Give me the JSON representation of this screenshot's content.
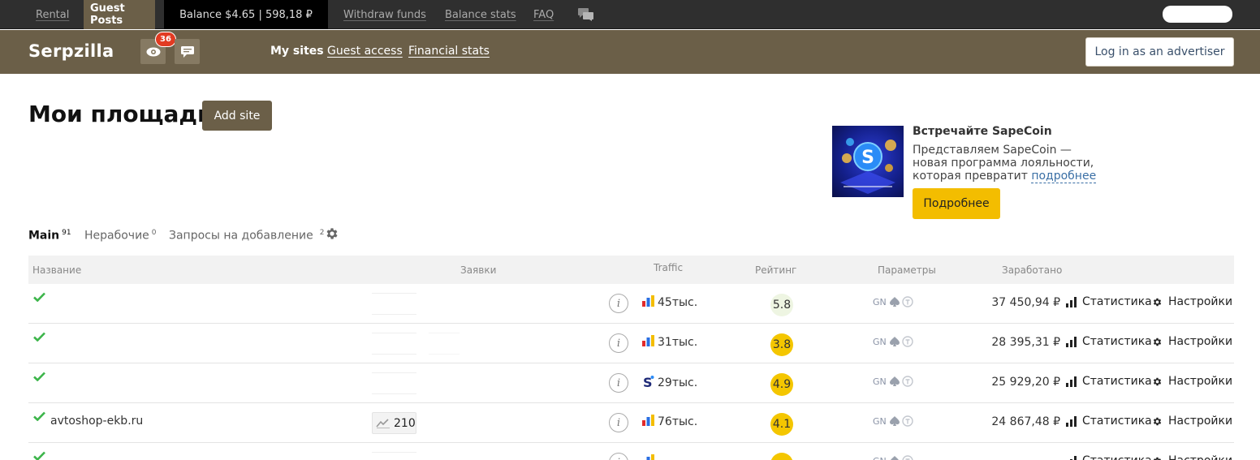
{
  "topbar": {
    "rental": "Rental",
    "guest_posts": "Guest Posts",
    "balance": "Balance $4.65 | 598,18 ₽",
    "withdraw": "Withdraw funds",
    "balance_stats": "Balance stats",
    "faq": "FAQ"
  },
  "header": {
    "logo": "Serpzilla",
    "views_badge": "36",
    "nav": {
      "my_sites": "My sites",
      "guest_access": "Guest access",
      "financial_stats": "Financial stats"
    },
    "advertiser_button": "Log in as an advertiser"
  },
  "page": {
    "title": "Мои площадки",
    "add_site": "Add site"
  },
  "promo": {
    "title": "Встречайте SapeCoin",
    "text": "Представляем SapeCoin — новая программа лояльности, которая превратит",
    "link": "подробнее",
    "button": "Подробнее"
  },
  "tabs": [
    {
      "label": "Main",
      "count": "91"
    },
    {
      "label": "Нерабочие",
      "count": "0"
    },
    {
      "label": "Запросы на добавление",
      "count": "2"
    }
  ],
  "table": {
    "columns": {
      "name": "Название",
      "requests": "Заявки",
      "traffic": "Traffic",
      "rating": "Рейтинг",
      "params": "Параметры",
      "earned": "Заработано"
    },
    "gn_label": "GN",
    "stat_label": "Статистика",
    "settings_label": "Настройки",
    "rows": [
      {
        "name": "",
        "requests": "",
        "traffic": "45тыс.",
        "traffic_src": "yandex",
        "rating": "5.8",
        "rating_color": "#eef5e2",
        "earned": "37 450,94 ₽"
      },
      {
        "name": "",
        "requests": "",
        "traffic": "31тыс.",
        "traffic_src": "yandex",
        "rating": "3.8",
        "rating_color": "#f4c600",
        "earned": "28 395,31 ₽"
      },
      {
        "name": "",
        "requests": "",
        "traffic": "29тыс.",
        "traffic_src": "sape",
        "rating": "4.9",
        "rating_color": "#f4c600",
        "earned": "25 929,20 ₽"
      },
      {
        "name": "avtoshop-ekb.ru",
        "requests": "210",
        "traffic": "76тыс.",
        "traffic_src": "yandex",
        "rating": "4.1",
        "rating_color": "#f4c600",
        "earned": "24 867,48 ₽"
      },
      {
        "name": "",
        "requests": "",
        "traffic": "",
        "traffic_src": "yandex",
        "rating": "",
        "rating_color": "#f4c600",
        "earned": ""
      }
    ]
  },
  "colors": {
    "brand": "#6b5f48",
    "topbar": "#2f2f2f",
    "accent_yellow": "#f3bd00",
    "check_green": "#3cb54a",
    "badge_red": "#e23b22"
  }
}
